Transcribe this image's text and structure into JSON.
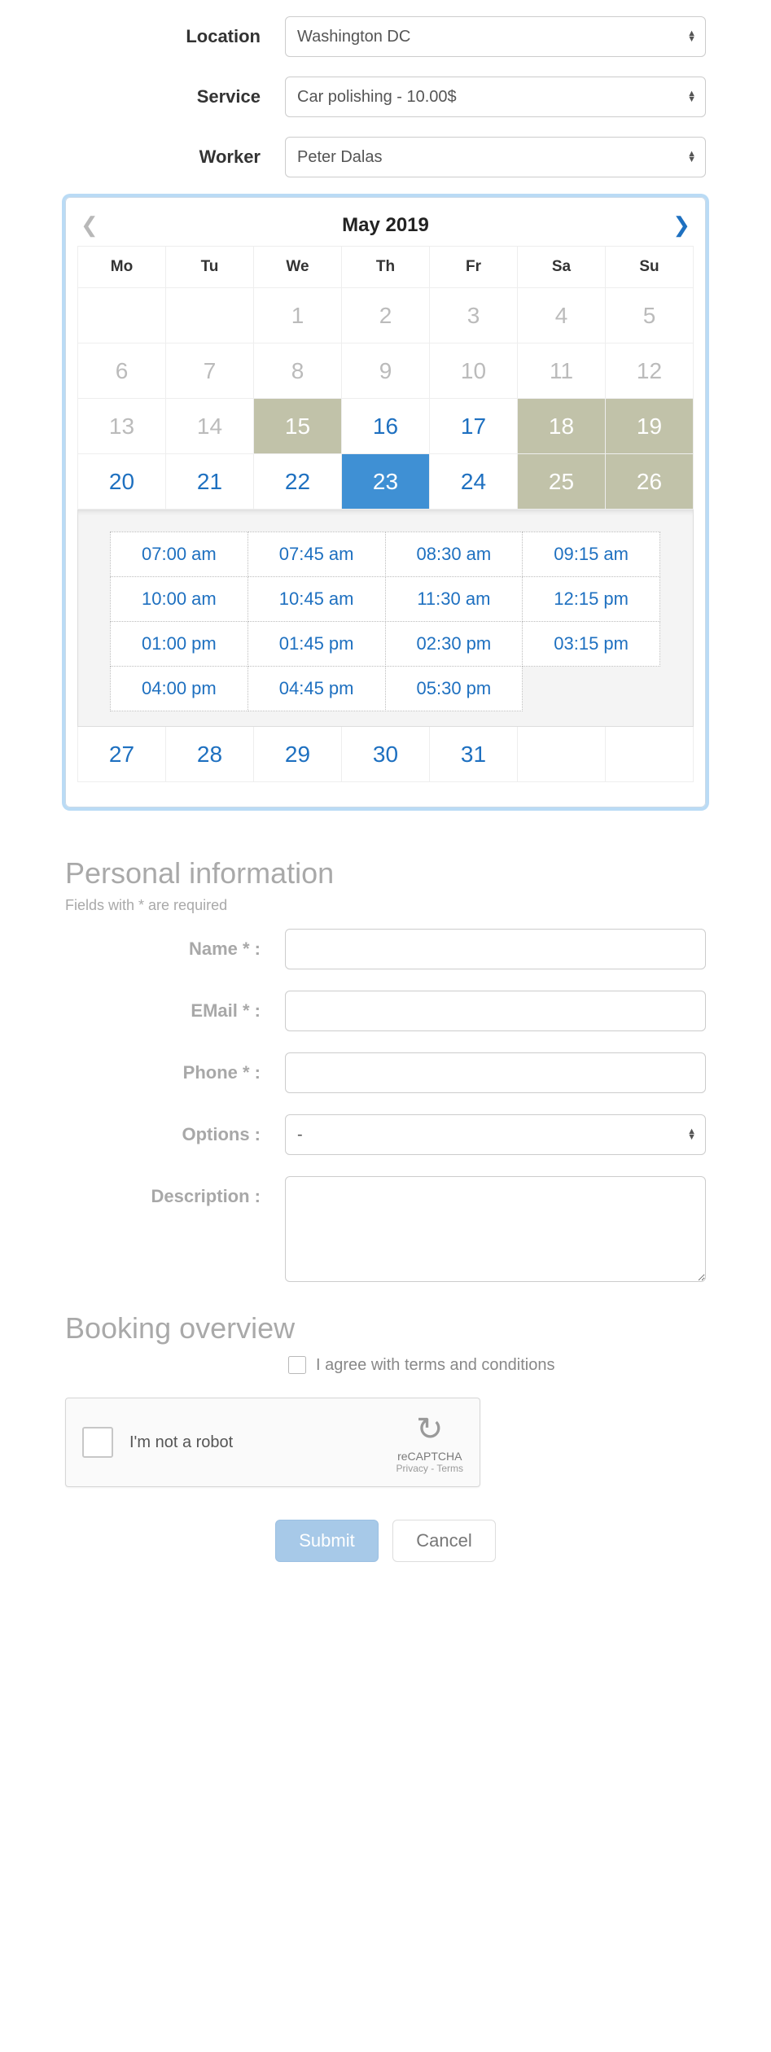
{
  "topForm": {
    "location": {
      "label": "Location",
      "value": "Washington DC"
    },
    "service": {
      "label": "Service",
      "value": "Car polishing - 10.00$"
    },
    "worker": {
      "label": "Worker",
      "value": "Peter Dalas"
    }
  },
  "calendar": {
    "title": "May 2019",
    "dow": [
      "Mo",
      "Tu",
      "We",
      "Th",
      "Fr",
      "Sa",
      "Su"
    ],
    "weeks": [
      [
        {
          "d": "",
          "s": "empty"
        },
        {
          "d": "",
          "s": "empty"
        },
        {
          "d": "1",
          "s": "past"
        },
        {
          "d": "2",
          "s": "past"
        },
        {
          "d": "3",
          "s": "past"
        },
        {
          "d": "4",
          "s": "past"
        },
        {
          "d": "5",
          "s": "past"
        }
      ],
      [
        {
          "d": "6",
          "s": "past"
        },
        {
          "d": "7",
          "s": "past"
        },
        {
          "d": "8",
          "s": "past"
        },
        {
          "d": "9",
          "s": "past"
        },
        {
          "d": "10",
          "s": "past"
        },
        {
          "d": "11",
          "s": "past"
        },
        {
          "d": "12",
          "s": "past"
        }
      ],
      [
        {
          "d": "13",
          "s": "past"
        },
        {
          "d": "14",
          "s": "past"
        },
        {
          "d": "15",
          "s": "closed"
        },
        {
          "d": "16",
          "s": "avail"
        },
        {
          "d": "17",
          "s": "avail"
        },
        {
          "d": "18",
          "s": "closed"
        },
        {
          "d": "19",
          "s": "closed"
        }
      ],
      [
        {
          "d": "20",
          "s": "avail"
        },
        {
          "d": "21",
          "s": "avail"
        },
        {
          "d": "22",
          "s": "avail"
        },
        {
          "d": "23",
          "s": "selected"
        },
        {
          "d": "24",
          "s": "avail"
        },
        {
          "d": "25",
          "s": "closed"
        },
        {
          "d": "26",
          "s": "closed"
        }
      ],
      [
        {
          "d": "27",
          "s": "avail"
        },
        {
          "d": "28",
          "s": "avail"
        },
        {
          "d": "29",
          "s": "avail"
        },
        {
          "d": "30",
          "s": "avail"
        },
        {
          "d": "31",
          "s": "avail"
        },
        {
          "d": "",
          "s": "empty"
        },
        {
          "d": "",
          "s": "empty"
        }
      ]
    ],
    "slotsAfterWeekIndex": 3,
    "slots": [
      "07:00 am",
      "07:45 am",
      "08:30 am",
      "09:15 am",
      "10:00 am",
      "10:45 am",
      "11:30 am",
      "12:15 pm",
      "01:00 pm",
      "01:45 pm",
      "02:30 pm",
      "03:15 pm",
      "04:00 pm",
      "04:45 pm",
      "05:30 pm"
    ]
  },
  "personal": {
    "heading": "Personal information",
    "hint": "Fields with * are required",
    "name": {
      "label": "Name * :"
    },
    "email": {
      "label": "EMail * :"
    },
    "phone": {
      "label": "Phone * :"
    },
    "options": {
      "label": "Options :",
      "value": "-"
    },
    "desc": {
      "label": "Description :"
    }
  },
  "overview": {
    "heading": "Booking overview"
  },
  "agree": {
    "label": "I agree with terms and conditions"
  },
  "recaptcha": {
    "text": "I'm not a robot",
    "brand": "reCAPTCHA",
    "links": "Privacy - Terms"
  },
  "buttons": {
    "submit": "Submit",
    "cancel": "Cancel"
  }
}
